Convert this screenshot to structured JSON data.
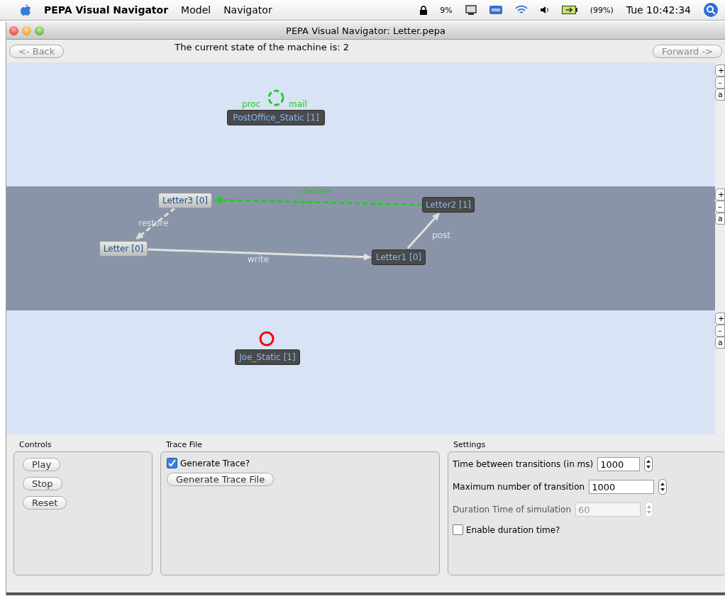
{
  "menu_bar": {
    "app_name": "PEPA Visual Navigator",
    "menus": [
      "Model",
      "Navigator"
    ],
    "cpu": "9%",
    "battery": "(99%)",
    "clock": "Tue 10:42:34"
  },
  "window": {
    "title": "PEPA Visual Navigator: Letter.pepa"
  },
  "toolbar": {
    "back": "<- Back",
    "status": "The current state of the machine is: 2",
    "forward": "Forward ->"
  },
  "lanes": [
    {
      "selected": false,
      "zoom_buttons": [
        "+",
        "–",
        "a"
      ],
      "nodes": [
        {
          "label": "PostOffice_Static [1]",
          "active": true
        }
      ],
      "edges": [
        {
          "kind": "loop",
          "color": "#22cc22",
          "dashed": true,
          "labels": [
            "proc",
            "mail"
          ]
        }
      ]
    },
    {
      "selected": true,
      "zoom_buttons": [
        "+",
        "–",
        "a"
      ],
      "nodes": [
        {
          "label": "Letter3 [0]",
          "active": false
        },
        {
          "label": "Letter2 [1]",
          "active": true
        },
        {
          "label": "Letter [0]",
          "active": false
        },
        {
          "label": "Letter1 [0]",
          "active": true
        }
      ],
      "edges": [
        {
          "kind": "arrow",
          "color": "#22cc22",
          "dashed": true,
          "labels": [
            "deliver"
          ]
        },
        {
          "kind": "arrow",
          "color": "#e0e0e0",
          "dashed": true,
          "labels": [
            "restore"
          ]
        },
        {
          "kind": "arrow",
          "color": "#e0e0e0",
          "dashed": false,
          "labels": [
            "write"
          ]
        },
        {
          "kind": "arrow",
          "color": "#e0e0e0",
          "dashed": false,
          "labels": [
            "post"
          ]
        }
      ]
    },
    {
      "selected": false,
      "zoom_buttons": [
        "+",
        "–",
        "a"
      ],
      "nodes": [
        {
          "label": "Joe_Static [1]",
          "active": true
        }
      ],
      "edges": [
        {
          "kind": "loop",
          "color": "#ff0000",
          "dashed": false
        }
      ]
    }
  ],
  "controls": {
    "title": "Controls",
    "buttons": [
      "Play",
      "Stop",
      "Reset"
    ]
  },
  "trace_file": {
    "title": "Trace File",
    "checkbox": {
      "label": "Generate Trace?",
      "checked": true
    },
    "button": "Generate Trace File"
  },
  "settings": {
    "title": "Settings",
    "fields": [
      {
        "label": "Time between transitions (in ms)",
        "value": "1000",
        "disabled": false
      },
      {
        "label": "Maximum number of transition",
        "value": "1000",
        "disabled": false
      },
      {
        "label": "Duration Time of simulation",
        "value": "60",
        "disabled": true
      }
    ],
    "checkbox": {
      "label": "Enable duration time?",
      "checked": false
    }
  }
}
